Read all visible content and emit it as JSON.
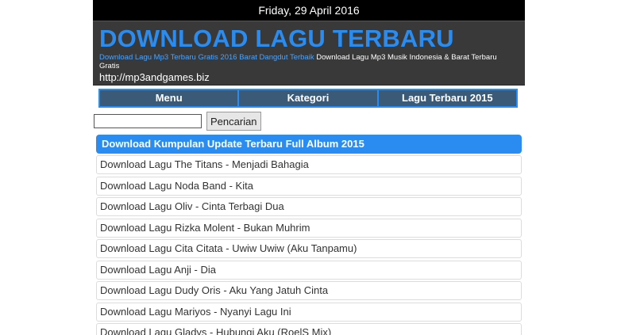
{
  "date": "Friday, 29 April 2016",
  "header": {
    "title": "DOWNLOAD LAGU TERBARU",
    "tagline_link": "Download Lagu Mp3 Terbaru Gratis 2016 Barat Dangdut Terbaik",
    "tagline_text": "Download Lagu Mp3 Musik Indonesia & Barat Terbaru Gratis",
    "url": "http://mp3andgames.biz"
  },
  "nav": {
    "items": [
      {
        "label": "Menu"
      },
      {
        "label": "Kategori"
      },
      {
        "label": "Lagu Terbaru 2015"
      }
    ]
  },
  "search": {
    "value": "",
    "button_label": "Pencarian"
  },
  "list": {
    "heading": "Download Kumpulan Update Terbaru Full Album 2015",
    "items": [
      "Download Lagu The Titans - Menjadi Bahagia",
      "Download Lagu Noda Band - Kita",
      "Download Lagu Oliv - Cinta Terbagi Dua",
      "Download Lagu Rizka Molent - Bukan Muhrim",
      "Download Lagu Cita Citata - Uwiw Uwiw (Aku Tanpamu)",
      "Download Lagu Anji - Dia",
      "Download Lagu Dudy Oris - Aku Yang Jatuh Cinta",
      "Download Lagu Mariyos - Nyanyi Lagu Ini",
      "Download Lagu Gladys - Hubungi Aku (RoelS Mix)"
    ]
  },
  "colors": {
    "accent": "#2a8cf0",
    "header_bg": "#393939",
    "nav_bg": "#3b5a78",
    "date_bg": "#000000"
  }
}
